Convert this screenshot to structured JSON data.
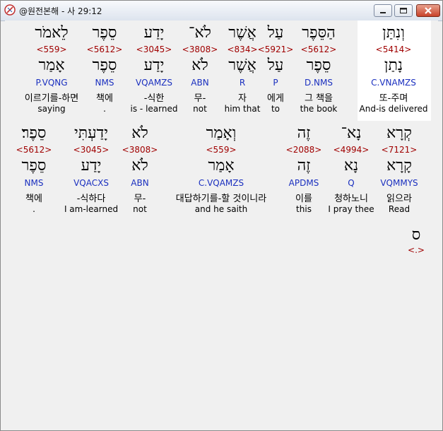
{
  "window": {
    "title": "@원전본해 - 사 29:12"
  },
  "row1": [
    {
      "heb": "וְנִתַּן",
      "strong": "<5414>",
      "lemma": "נָתַן",
      "morph": "C.VNAMZS",
      "kor": "또-주며",
      "eng": "And-is delivered"
    },
    {
      "heb": "הַסֵּפֶר",
      "strong": "<5612>",
      "lemma": "סֵפֶר",
      "morph": "D.NMS",
      "kor": "그 책을",
      "eng": "the book"
    },
    {
      "heb": "עַל",
      "strong": "<5921>",
      "lemma": "עַל",
      "morph": "P",
      "kor": "에게",
      "eng": "to"
    },
    {
      "heb": "אֲשֶׁר",
      "strong": "<834>",
      "lemma": "אֲשֶׁר",
      "morph": "R",
      "kor": "자",
      "eng": "him that"
    },
    {
      "heb": "לֹא־",
      "strong": "<3808>",
      "lemma": "לֹא",
      "morph": "ABN",
      "kor": "무-",
      "eng": "not"
    },
    {
      "heb": "יָדַע",
      "strong": "<3045>",
      "lemma": "יָדַע",
      "morph": "VQAMZS",
      "kor": "-식한",
      "eng": "is - learned"
    },
    {
      "heb": "סֵפֶר",
      "strong": "<5612>",
      "lemma": "סֵפֶר",
      "morph": "NMS",
      "kor": "책에",
      "eng": "."
    },
    {
      "heb": "לֵאמֹר",
      "strong": "<559>",
      "lemma": "אָמַר",
      "morph": "P.VQNG",
      "kor": "이르기를-하면",
      "eng": "saying"
    }
  ],
  "row2": [
    {
      "heb": "קְרָא",
      "strong": "<7121>",
      "lemma": "קָרָא",
      "morph": "VQMMYS",
      "kor": "읽으라",
      "eng": "Read"
    },
    {
      "heb": "נָא־",
      "strong": "<4994>",
      "lemma": "נָא",
      "morph": "Q",
      "kor": "청하노니",
      "eng": "I pray thee"
    },
    {
      "heb": "זֶה",
      "strong": "<2088>",
      "lemma": "זֶה",
      "morph": "APDMS",
      "kor": "이를",
      "eng": "this"
    },
    {
      "heb": "וְאָמַר",
      "strong": "<559>",
      "lemma": "אָמַר",
      "morph": "C.VQAMZS",
      "kor": "대답하기를-할 것이니라",
      "eng": "and he saith"
    },
    {
      "heb": "לֹא",
      "strong": "<3808>",
      "lemma": "לֹא",
      "morph": "ABN",
      "kor": "무-",
      "eng": "not"
    },
    {
      "heb": "יָדַעְתִּי",
      "strong": "<3045>",
      "lemma": "יָדַע",
      "morph": "VQACXS",
      "kor": "-식하다",
      "eng": "I am-learned"
    },
    {
      "heb": "סֵפֶר׃",
      "strong": "<5612>",
      "lemma": "סֵפֶר",
      "morph": "NMS",
      "kor": "책에",
      "eng": "."
    }
  ],
  "row3": {
    "heb": "ס",
    "strong": "<.>"
  },
  "colors": {
    "strong": "#a00000",
    "morph": "#1a2fbf",
    "highlight": "#ffffff",
    "background": "#f0f0f0"
  }
}
